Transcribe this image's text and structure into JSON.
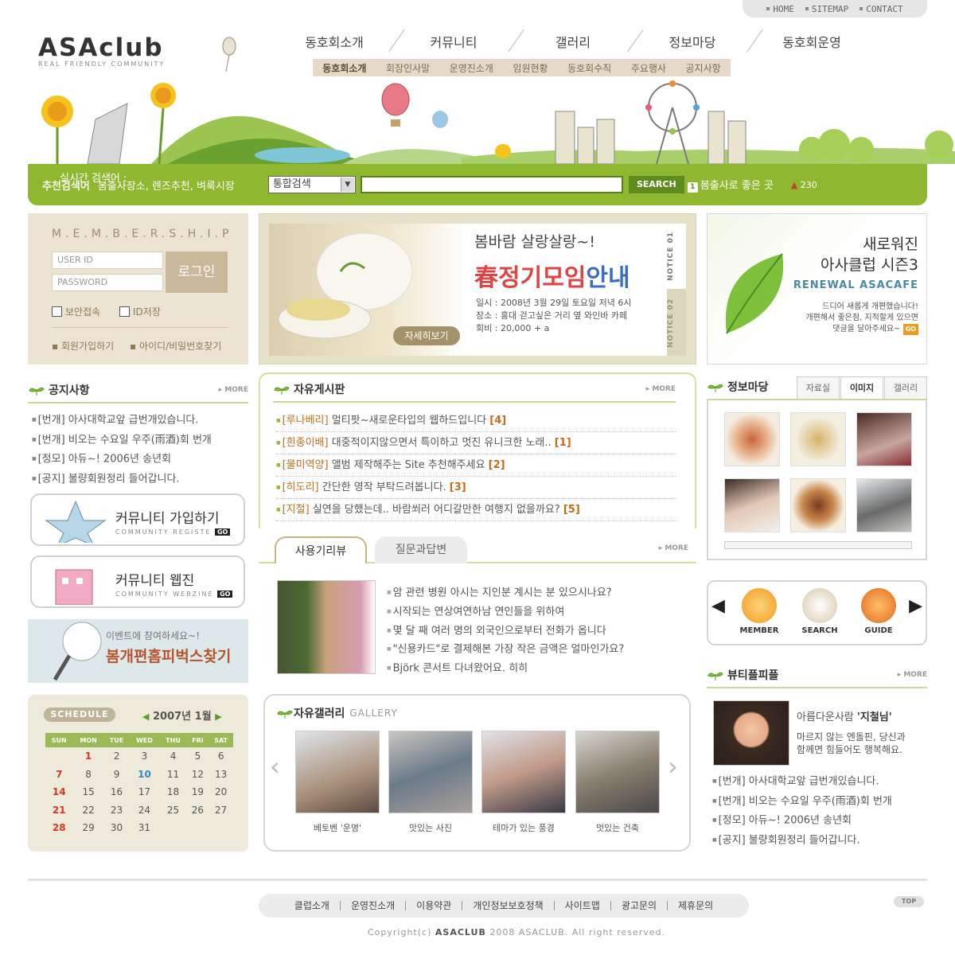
{
  "util": {
    "home": "HOME",
    "sitemap": "SITEMAP",
    "contact": "CONTACT"
  },
  "logo": {
    "title": "ASAclub",
    "tagline": "REAL FRIENDLY COMMUNITY"
  },
  "gnb": [
    "동호회소개",
    "커뮤니티",
    "갤러리",
    "정보마당",
    "동호회운영"
  ],
  "subnav": [
    "동호회소개",
    "회장인사말",
    "운영진소개",
    "임원현황",
    "동호회수칙",
    "주요행사",
    "공지사항"
  ],
  "search": {
    "rec_label": "추천검색어",
    "rec_keywords": "봄출사장소, 렌즈추천, 벼룩시장",
    "select_value": "통합검색",
    "button": "SEARCH",
    "realtime_label": "실시간 검색어 :",
    "realtime_rank": "1",
    "realtime_keyword": "봄출사로 좋은 곳",
    "count": "230"
  },
  "membership": {
    "title": "M.E.M.B.E.R.S.H.I.P",
    "user_placeholder": "USER ID",
    "pass_placeholder": "PASSWORD",
    "login": "로그인",
    "secure": "보안접속",
    "save_id": "ID저장",
    "join": "회원가입하기",
    "find": "아이디/비밀번호찾기"
  },
  "notice_banner": {
    "headline": "봄바람 살랑살랑~!",
    "title_red": "春정기모임",
    "title_blue": "안내",
    "info": [
      "일시 : 2008년 3월 29일 토요일 저녁 6시",
      "장소 : 홍대 걷고싶은 거리 옆 와인바 카페",
      "회비 : 20,000 + a"
    ],
    "more": "자세히보기",
    "tab1": "NOTICE 01",
    "tab2": "NOTICE 02"
  },
  "renewal": {
    "line1": "새로워진",
    "line2": "아사클럽 시즌3",
    "badge": "RENEWAL ASACAFE",
    "desc1": "드디어 새롭게 개편했습니다!",
    "desc2": "개편해서 좋은점, 지적할게 있으면",
    "desc3": "댓글을 달아주세요~",
    "go": "GO"
  },
  "notice": {
    "title": "공지사항",
    "more": "MORE",
    "items": [
      "[번개] 아사대학교앞 급번개있습니다.",
      "[번개] 비오는 수요일 우주(雨酒)회 번개",
      "[정모] 아듀~! 2006년 송년회",
      "[공지] 불량회원정리 들어갑니다."
    ]
  },
  "community": [
    {
      "title": "커뮤니티 가입하기",
      "sub": "COMMUNITY REGISTE",
      "go": "GO"
    },
    {
      "title": "커뮤니티 웹진",
      "sub": "COMMUNITY WEBZINE",
      "go": "GO"
    }
  ],
  "event": {
    "line1": "이벤트에 참여하세요~!",
    "line2": "봄개편홈피벅스찾기"
  },
  "schedule": {
    "label": "SCHEDULE",
    "month": "2007년 1월",
    "days": [
      "SUN",
      "MON",
      "TUE",
      "WED",
      "THU",
      "FRI",
      "SAT"
    ],
    "weeks": [
      [
        "",
        "1",
        "2",
        "3",
        "4",
        "5",
        "6"
      ],
      [
        "7",
        "8",
        "9",
        "10",
        "11",
        "12",
        "13"
      ],
      [
        "14",
        "15",
        "16",
        "17",
        "18",
        "19",
        "20"
      ],
      [
        "21",
        "22",
        "23",
        "24",
        "25",
        "26",
        "27"
      ],
      [
        "28",
        "29",
        "30",
        "31",
        "",
        "",
        ""
      ]
    ]
  },
  "board": {
    "title": "자유게시판",
    "more": "MORE",
    "posts": [
      {
        "nick": "[루나베리]",
        "text": " 멀티팟~새로운타입의 웹하드입니다 ",
        "count": "[4]"
      },
      {
        "nick": "[흰종이배]",
        "text": " 대중적이지않으면서 특이하고 멋진 유니크한 노래.. ",
        "count": "[1]"
      },
      {
        "nick": "[물미역양]",
        "text": " 앨범 제작해주는 Site 추천해주세요 ",
        "count": "[2]"
      },
      {
        "nick": "[히도리]",
        "text": " 간단한 영작 부탁드려봅니다. ",
        "count": "[3]"
      },
      {
        "nick": "[지철]",
        "text": " 실연을 당했는데.. 바람쐬러 어디갈만한 여행지 없을까요? ",
        "count": "[5]"
      }
    ]
  },
  "review": {
    "tab_on": "사용기리뷰",
    "tab_off": "질문과답변",
    "more": "MORE",
    "items": [
      "암 관련 병원 아시는 지인분 계시는 분 있으시나요?",
      "시작되는 연상여연하남 연인들을 위하여",
      "몇 달 째 여러 명의 외국인으로부터 전화가 옵니다",
      "\"신용카드\"로 결제해본 가장 작은 금액은 얼마인가요?",
      "Björk 콘서트 다녀왔어요. 히히"
    ]
  },
  "gallery": {
    "title": "자유갤러리",
    "sub": "GALLERY",
    "items": [
      "베토벤 '운명'",
      "맛있는 사진",
      "테마가 있는 풍경",
      "멋있는 건축"
    ]
  },
  "info": {
    "title": "정보마당",
    "tabs": [
      "자료실",
      "이미지",
      "갤러리"
    ]
  },
  "quick": [
    "MEMBER",
    "SEARCH",
    "GUIDE"
  ],
  "beauty": {
    "title": "뷰티플피플",
    "more": "MORE",
    "name_pre": "아름다운사람 ",
    "name": "'지철님'",
    "desc1": "마르지 않는 엔돌핀, 당신과",
    "desc2": "함께면 힘들어도 행복해요.",
    "items": [
      "[번개] 아사대학교앞 급번개있습니다.",
      "[번개] 비오는 수요일 우주(雨酒)회 번개",
      "[정모] 아듀~! 2006년 송년회",
      "[공지] 불량회원정리 들어갑니다."
    ]
  },
  "footer": {
    "menu": [
      "클럽소개",
      "운영진소개",
      "이용약관",
      "개인정보보호정책",
      "사이트맵",
      "광고문의",
      "제휴문의"
    ],
    "copy_pre": "Copyright(c) ",
    "copy_brand": "ASACLUB",
    "copy_post": " 2008 ASACLUB. All right reserved.",
    "top": "TOP"
  }
}
